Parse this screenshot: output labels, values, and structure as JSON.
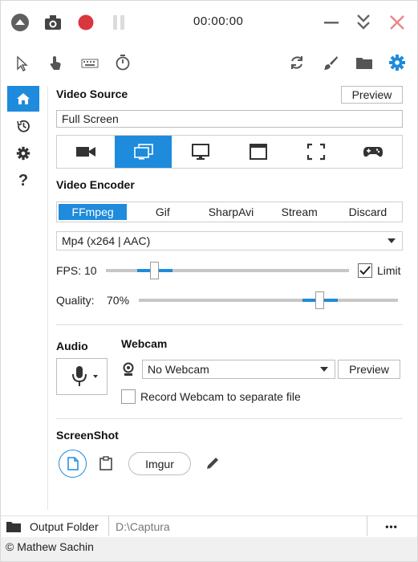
{
  "titlebar": {
    "timer": "00:00:00"
  },
  "video_source": {
    "title": "Video Source",
    "preview_label": "Preview",
    "selected": "Full Screen"
  },
  "video_encoder": {
    "title": "Video Encoder",
    "tabs": [
      "FFmpeg",
      "Gif",
      "SharpAvi",
      "Stream",
      "Discard"
    ],
    "active_tab": "FFmpeg",
    "format": "Mp4 (x264 | AAC)",
    "fps_label": "FPS:",
    "fps_value": "10",
    "fps_level": 0.2,
    "limit_label": "Limit",
    "limit_checked": true,
    "quality_label": "Quality:",
    "quality_value": "70%",
    "quality_level": 0.7
  },
  "audio": {
    "title": "Audio"
  },
  "webcam": {
    "title": "Webcam",
    "selected": "No Webcam",
    "preview_label": "Preview",
    "separate_file_label": "Record Webcam to separate file"
  },
  "screenshot": {
    "title": "ScreenShot",
    "imgur_label": "Imgur"
  },
  "output": {
    "label": "Output Folder",
    "path": "D:\\Captura",
    "more_label": "•••"
  },
  "status": {
    "author": "© Mathew Sachin"
  },
  "colors": {
    "accent": "#1e8bdc",
    "record": "#d9363e",
    "close": "#e8868a"
  }
}
